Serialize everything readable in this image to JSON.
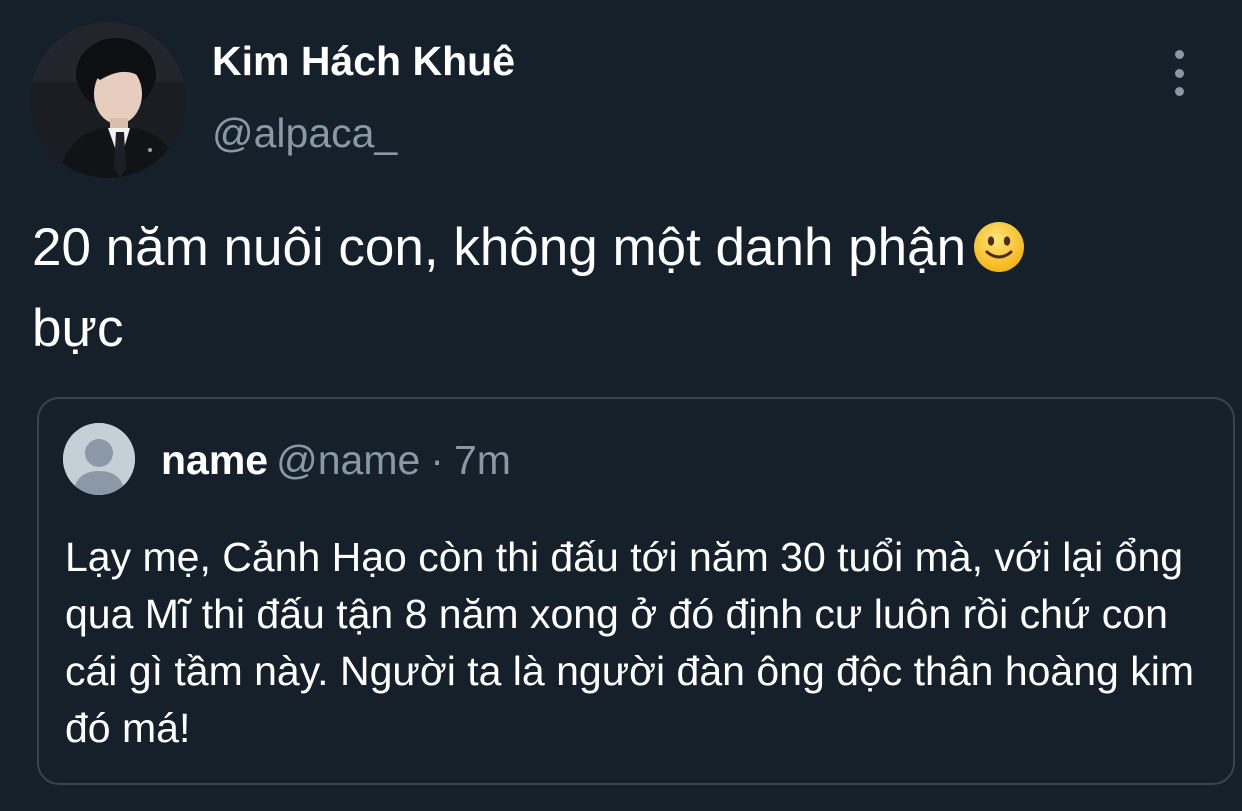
{
  "tweet": {
    "author": {
      "display_name": "Kim Hách Khuê",
      "handle": "@alpaca_"
    },
    "text": "20 năm nuôi con, không một danh phận",
    "text_end": "bực",
    "emoji": "slightly-smiling-face-emoji",
    "menu_icon": "more-vertical-icon"
  },
  "quoted": {
    "author_name": "name",
    "handle": "@name",
    "separator": "·",
    "time": "7m",
    "avatar_icon": "default-profile-icon",
    "text": "Lạy mẹ, Cảnh Hạo còn thi đấu tới năm 30 tuổi mà, với lại ổng qua Mĩ thi đấu tận 8 năm xong ở đó định cư luôn rồi chứ con cái gì tầm này. Người ta là người đàn ông độc thân hoàng kim đó má!"
  },
  "colors": {
    "background": "#15202b",
    "text_primary": "#ffffff",
    "text_secondary": "#8899a6",
    "border": "#38444d"
  }
}
